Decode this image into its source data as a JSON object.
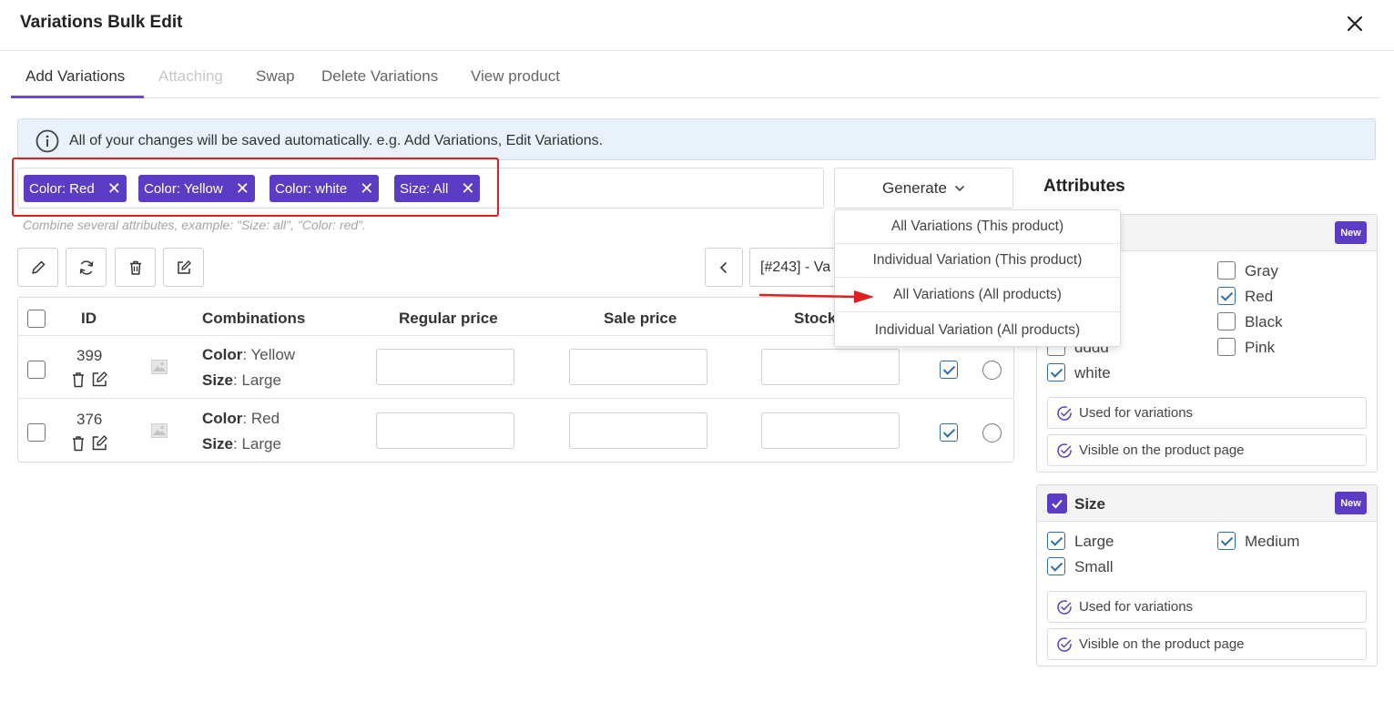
{
  "header": {
    "title": "Variations Bulk Edit"
  },
  "tabs": [
    {
      "label": "Add Variations"
    },
    {
      "label": "Attaching"
    },
    {
      "label": "Swap"
    },
    {
      "label": "Delete Variations"
    },
    {
      "label": "View product"
    }
  ],
  "banner": {
    "text": "All of your changes will be saved automatically. e.g. Add Variations, Edit Variations."
  },
  "chips": [
    {
      "label": "Color: Red"
    },
    {
      "label": "Color: Yellow"
    },
    {
      "label": "Color: white"
    },
    {
      "label": "Size: All"
    }
  ],
  "chip_remove": "✕",
  "hint": "Combine several attributes, example: \"Size: all\", \"Color: red\".",
  "generate": {
    "label": "Generate",
    "menu": [
      "All Variations (This product)",
      "Individual Variation (This product)",
      "All Variations (All products)",
      "Individual Variation (All products)"
    ]
  },
  "product_select": {
    "value": "[#243] - Va"
  },
  "table": {
    "headers": {
      "id": "ID",
      "combinations": "Combinations",
      "regular_price": "Regular price",
      "sale_price": "Sale price",
      "stock": "Stock"
    },
    "rows": [
      {
        "id": "399",
        "attr1_name": "Color",
        "attr1_value": ": Yellow",
        "attr2_name": "Size",
        "attr2_value": ": Large"
      },
      {
        "id": "376",
        "attr1_name": "Color",
        "attr1_value": ": Red",
        "attr2_name": "Size",
        "attr2_value": ": Large"
      }
    ]
  },
  "attributes": {
    "title": "Attributes",
    "new_badge": "New",
    "color": {
      "options": [
        {
          "label": "Gray",
          "checked": false
        },
        {
          "label": "Red",
          "checked": true
        },
        {
          "label": "Black",
          "checked": false
        },
        {
          "label": "dddd",
          "checked": false
        },
        {
          "label": "Pink",
          "checked": false
        },
        {
          "label": "white",
          "checked": true
        }
      ],
      "used_for_variations": "Used for variations",
      "visible_on_product_page": "Visible on the product page"
    },
    "size": {
      "name": "Size",
      "options": [
        {
          "label": "Large",
          "checked": true
        },
        {
          "label": "Medium",
          "checked": true
        },
        {
          "label": "Small",
          "checked": true
        }
      ],
      "used_for_variations": "Used for variations",
      "visible_on_product_page": "Visible on the product page"
    }
  },
  "colors": {
    "accent": "#5b3cc4",
    "highlight": "#e0201f",
    "banner_bg": "#e9f1fb",
    "check": "#2f6fa8"
  }
}
